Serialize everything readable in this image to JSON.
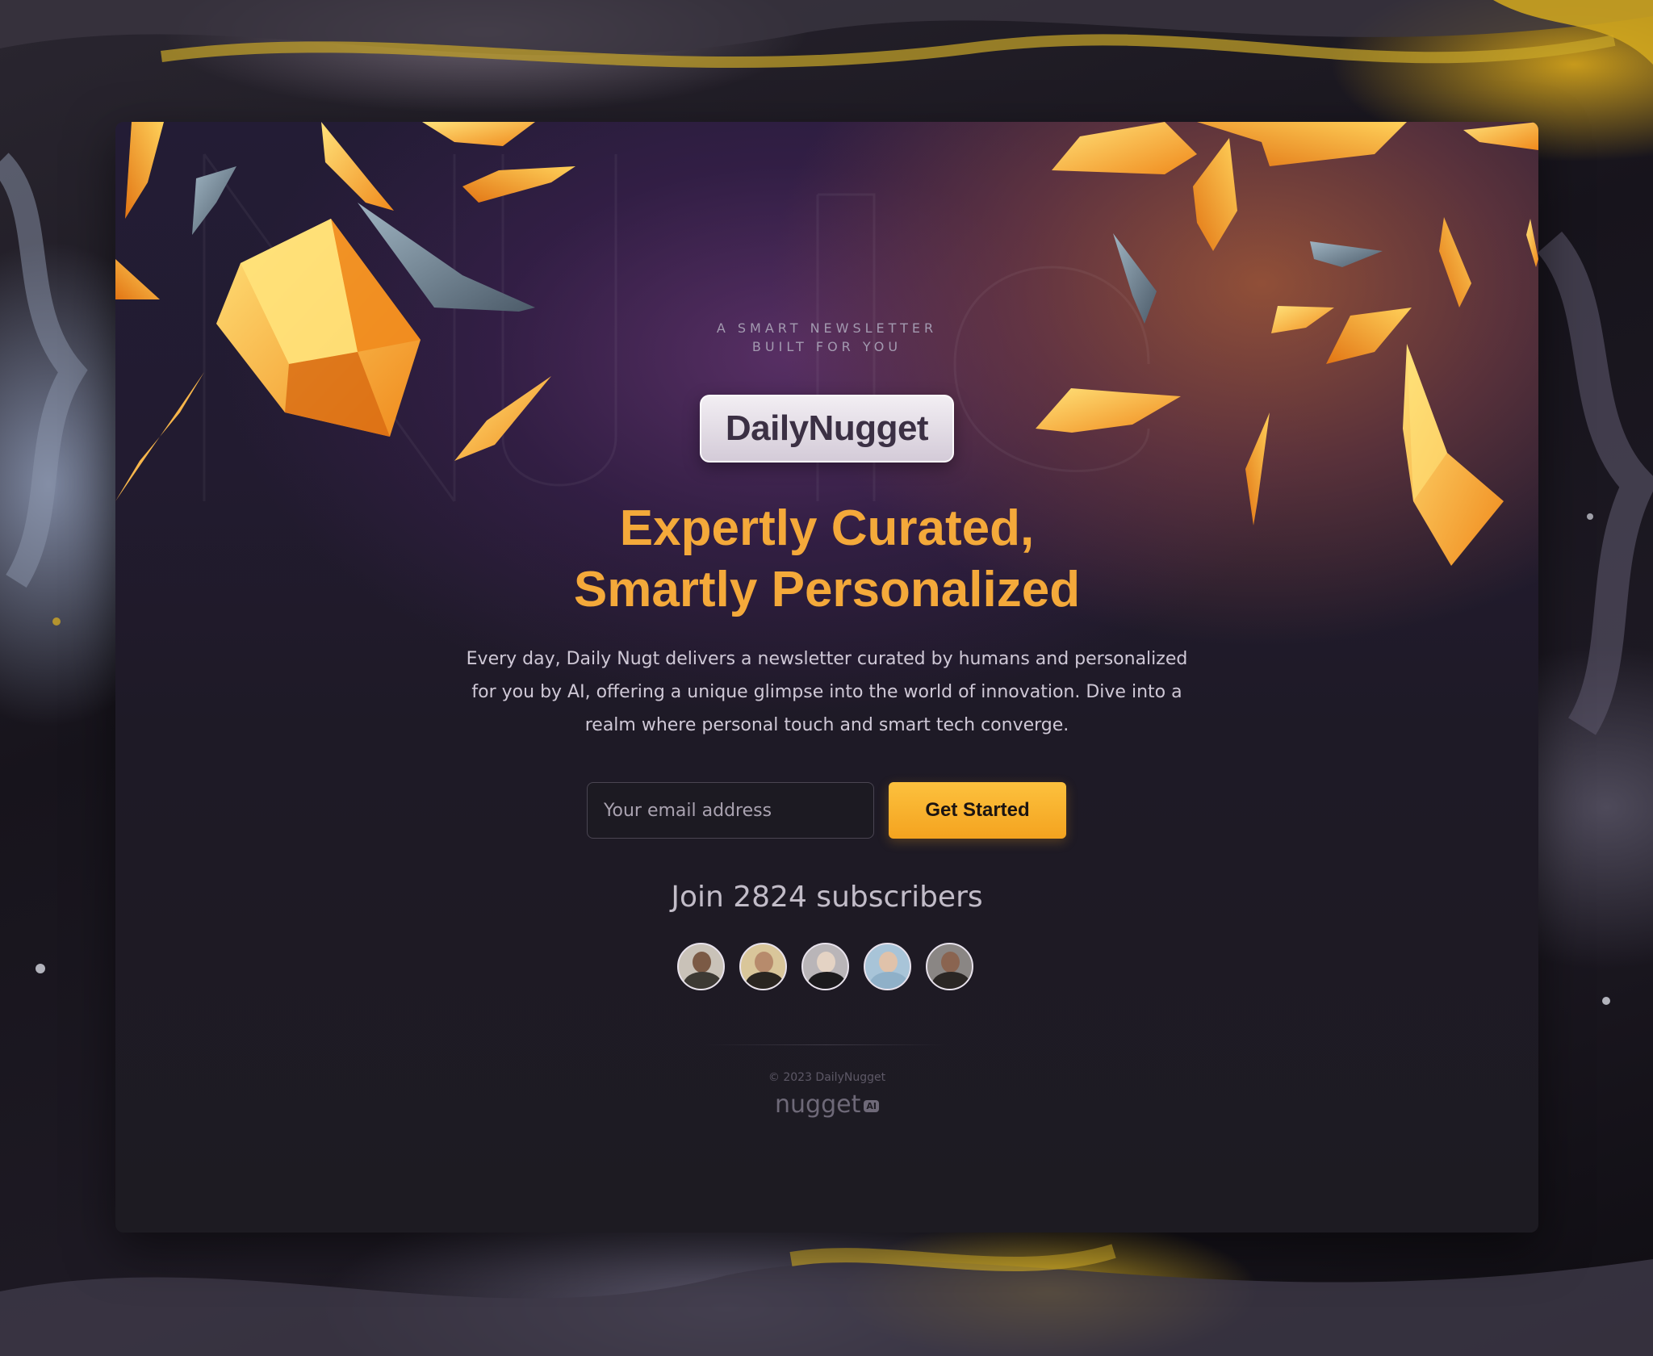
{
  "hero": {
    "eyebrow_line1": "A SMART NEWSLETTER",
    "eyebrow_line2": "BUILT FOR YOU",
    "logo_text": "DailyNugget",
    "headline_line1": "Expertly Curated,",
    "headline_line2": "Smartly Personalized",
    "description": "Every day, Daily Nugt delivers a newsletter curated by humans and personalized for you by AI, offering a unique glimpse into the world of innovation. Dive into a realm where personal touch and smart tech converge."
  },
  "signup": {
    "email_placeholder": "Your email address",
    "button_label": "Get Started"
  },
  "subscribers": {
    "text": "Join 2824 subscribers",
    "avatars": [
      "avatar-1",
      "avatar-2",
      "avatar-3",
      "avatar-4",
      "avatar-5"
    ]
  },
  "footer": {
    "copyright": "© 2023 DailyNugget",
    "brand_word": "nugget",
    "brand_badge": "AI"
  },
  "colors": {
    "accent": "#f4a93a",
    "button": "#fcb52f",
    "card_bg": "#1d1b22"
  }
}
